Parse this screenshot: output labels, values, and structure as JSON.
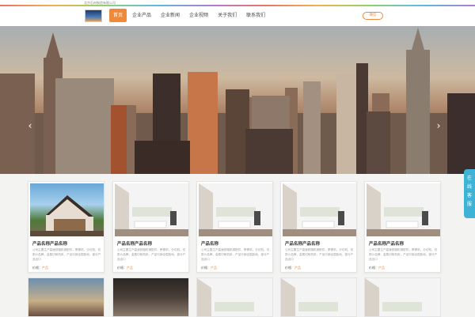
{
  "header": {
    "company": "北京石材制造有限公司",
    "logo_icon": "building-logo-icon",
    "wechat_label": "微信"
  },
  "nav": [
    {
      "label": "首页",
      "active": true
    },
    {
      "label": "企业产品",
      "active": false
    },
    {
      "label": "企业新闻",
      "active": false
    },
    {
      "label": "企业视频",
      "active": false
    },
    {
      "label": "关于我们",
      "active": false
    },
    {
      "label": "联系我们",
      "active": false
    }
  ],
  "banner": {
    "prev_arrow": "‹",
    "next_arrow": "›"
  },
  "online": {
    "label": "在线客服"
  },
  "products": [
    {
      "title": "产品名称产品名称",
      "desc": "公司主要生产高速铁路机械配件，摩擦机，分切机，切割小品牌，金属切削机床，产品行销全国各地，部分产品出口",
      "price_label": "价格：",
      "price": "产品"
    },
    {
      "title": "产品名称产品名称",
      "desc": "公司主要生产高速铁路机械配件，摩擦机，分切机，切割小品牌，金属切削机床，产品行销全国各地，部分产品出口",
      "price_label": "价格：",
      "price": "产品"
    },
    {
      "title": "产品名称",
      "desc": "公司主要生产高速铁路机械配件，摩擦机，分切机，切割小品牌，金属切削机床，产品行销全国各地，部分产品出口",
      "price_label": "价格：",
      "price": "产品"
    },
    {
      "title": "产品名称产品名称",
      "desc": "公司主要生产高速铁路机械配件，摩擦机，分切机，切割小品牌，金属切削机床，产品行销全国各地，部分产品出口",
      "price_label": "价格：",
      "price": "产品"
    },
    {
      "title": "产品名称产品名称",
      "desc": "公司主要生产高速铁路机械配件，摩擦机，分切机，切割小品牌，金属切削机床，产品行销全国各地，部分产品出口",
      "price_label": "价格：",
      "price": "产品"
    }
  ],
  "colors": {
    "accent": "#f08a3a",
    "online": "#3fb3d6"
  }
}
